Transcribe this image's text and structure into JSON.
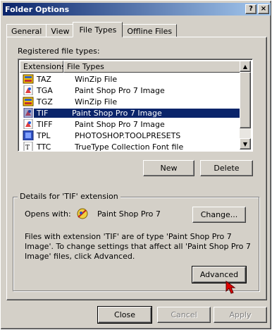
{
  "window": {
    "title": "Folder Options",
    "help_button": "?",
    "close_button": "×"
  },
  "tabs": [
    {
      "label": "General",
      "active": false
    },
    {
      "label": "View",
      "active": false
    },
    {
      "label": "File Types",
      "active": true
    },
    {
      "label": "Offline Files",
      "active": false
    }
  ],
  "registered": {
    "label": "Registered file types:",
    "columns": [
      "Extensions",
      "File Types"
    ],
    "rows": [
      {
        "ext": "TAZ",
        "type": "WinZip File",
        "icon": "winzip-icon",
        "selected": false
      },
      {
        "ext": "TGA",
        "type": "Paint Shop Pro 7 Image",
        "icon": "psp-image-icon",
        "selected": false
      },
      {
        "ext": "TGZ",
        "type": "WinZip File",
        "icon": "winzip-icon",
        "selected": false
      },
      {
        "ext": "TIF",
        "type": "Paint Shop Pro 7 Image",
        "icon": "psp-image-icon",
        "selected": true
      },
      {
        "ext": "TIFF",
        "type": "Paint Shop Pro 7 Image",
        "icon": "psp-image-icon",
        "selected": false
      },
      {
        "ext": "TPL",
        "type": "PHOTOSHOP.TOOLPRESETS",
        "icon": "photoshop-icon",
        "selected": false
      },
      {
        "ext": "TTC",
        "type": "TrueType Collection Font file",
        "icon": "font-file-icon",
        "selected": false
      }
    ]
  },
  "buttons": {
    "new": "New",
    "delete": "Delete",
    "change": "Change...",
    "advanced": "Advanced",
    "close": "Close",
    "cancel": "Cancel",
    "apply": "Apply"
  },
  "details": {
    "group_label": "Details for 'TIF' extension",
    "opens_with_label": "Opens with:",
    "opens_with_app": "Paint Shop Pro 7",
    "description": "Files with extension 'TIF' are of type 'Paint Shop Pro 7 Image'.  To change settings that affect all 'Paint Shop Pro 7 Image' files, click Advanced."
  },
  "colors": {
    "selection": "#0a246a",
    "face": "#d4d0c8",
    "cursor": "#e00000"
  }
}
